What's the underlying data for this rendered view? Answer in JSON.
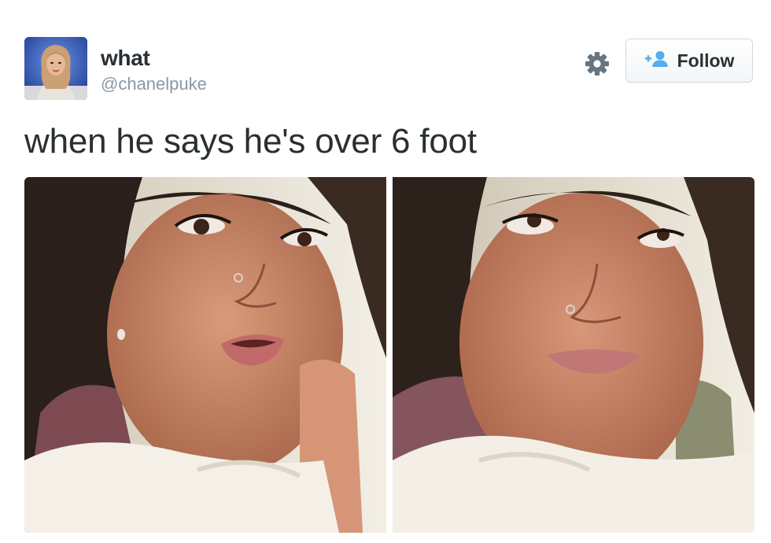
{
  "tweet": {
    "author": {
      "display_name": "what",
      "handle": "@chanelpuke",
      "avatar_icon": "profile-avatar"
    },
    "text": "when he says he's over 6 foot",
    "actions": {
      "settings_icon": "gear-icon",
      "follow_icon": "add-user-icon",
      "follow_label": "Follow"
    },
    "media": [
      {
        "type": "photo",
        "icon": "photo-left"
      },
      {
        "type": "photo",
        "icon": "photo-right"
      }
    ]
  },
  "colors": {
    "text": "#292f33",
    "handle": "#8899a6",
    "accent": "#55acee",
    "button_border": "#cfd9de"
  }
}
